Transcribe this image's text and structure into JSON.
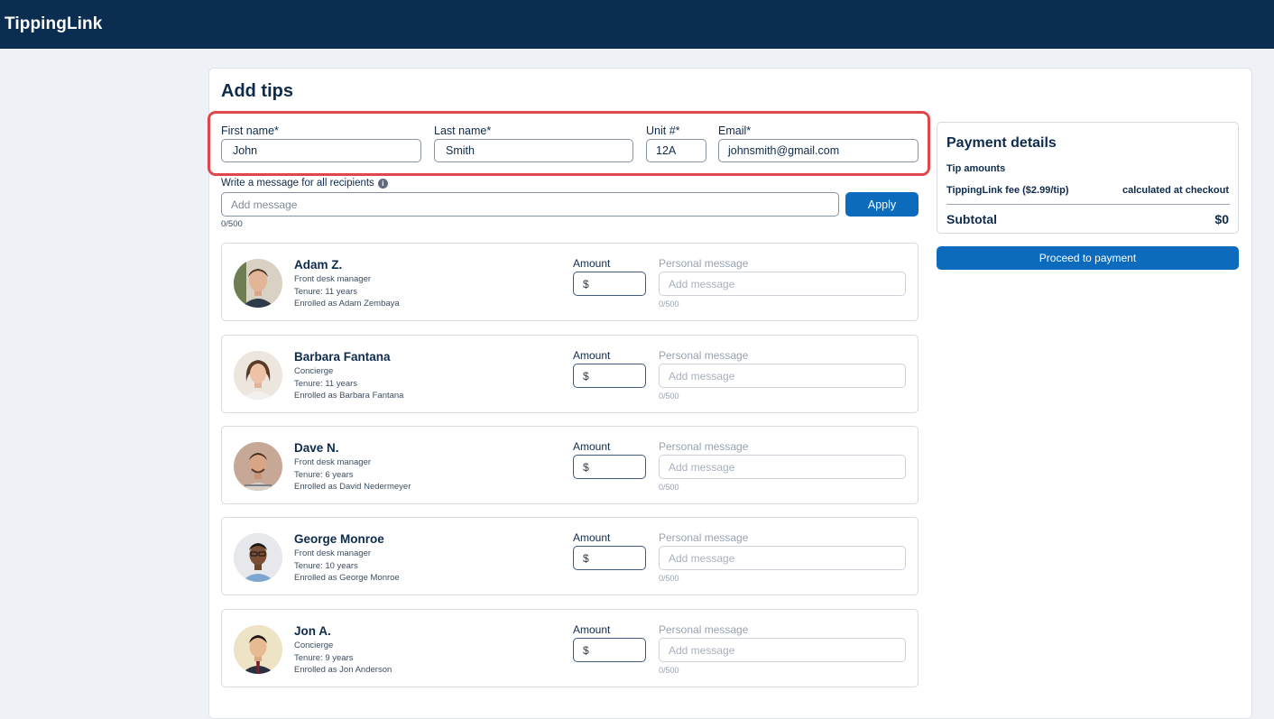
{
  "app": {
    "title": "TippingLink"
  },
  "page": {
    "title": "Add tips"
  },
  "form": {
    "first_name": {
      "label": "First name*",
      "value": "John"
    },
    "last_name": {
      "label": "Last name*",
      "value": "Smith"
    },
    "unit": {
      "label": "Unit #*",
      "value": "12A"
    },
    "email": {
      "label": "Email*",
      "value": "johnsmith@gmail.com"
    }
  },
  "group_message": {
    "label": "Write a message for all recipients",
    "placeholder": "Add message",
    "counter": "0/500",
    "apply_label": "Apply"
  },
  "recipients": [
    {
      "name": "Adam Z.",
      "role": "Front desk manager",
      "tenure": "Tenure: 11 years",
      "enrolled": "Enrolled as Adam Zembaya",
      "amount_label": "Amount",
      "currency": "$",
      "message_label": "Personal message",
      "message_placeholder": "Add message",
      "counter": "0/500"
    },
    {
      "name": "Barbara Fantana",
      "role": "Concierge",
      "tenure": "Tenure: 11 years",
      "enrolled": "Enrolled as Barbara Fantana",
      "amount_label": "Amount",
      "currency": "$",
      "message_label": "Personal message",
      "message_placeholder": "Add message",
      "counter": "0/500"
    },
    {
      "name": "Dave N.",
      "role": "Front desk manager",
      "tenure": "Tenure: 6 years",
      "enrolled": "Enrolled as David Nedermeyer",
      "amount_label": "Amount",
      "currency": "$",
      "message_label": "Personal message",
      "message_placeholder": "Add message",
      "counter": "0/500"
    },
    {
      "name": "George Monroe",
      "role": "Front desk manager",
      "tenure": "Tenure: 10 years",
      "enrolled": "Enrolled as George Monroe",
      "amount_label": "Amount",
      "currency": "$",
      "message_label": "Personal message",
      "message_placeholder": "Add message",
      "counter": "0/500"
    },
    {
      "name": "Jon A.",
      "role": "Concierge",
      "tenure": "Tenure: 9 years",
      "enrolled": "Enrolled as Jon Anderson",
      "amount_label": "Amount",
      "currency": "$",
      "message_label": "Personal message",
      "message_placeholder": "Add message",
      "counter": "0/500"
    }
  ],
  "payment": {
    "title": "Payment details",
    "tip_amounts_label": "Tip amounts",
    "fee_label": "TippingLink fee ($2.99/tip)",
    "fee_value": "calculated at checkout",
    "subtotal_label": "Subtotal",
    "subtotal_value": "$0",
    "proceed_label": "Proceed to payment"
  },
  "colors": {
    "header_bg": "#0b2d52",
    "primary_button": "#0c6bbd",
    "highlight_border": "#e0474c"
  },
  "icons": {
    "info": "info-icon"
  }
}
